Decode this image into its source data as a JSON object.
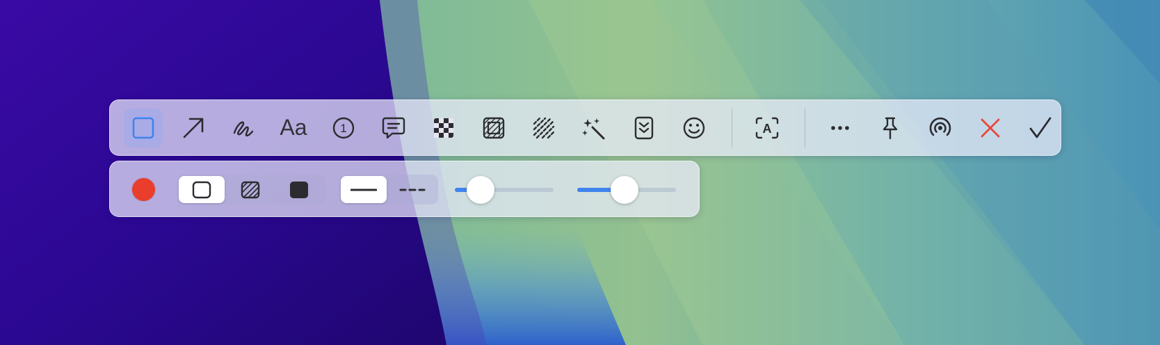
{
  "main_toolbar": {
    "tools": [
      {
        "name": "rectangle",
        "icon": "rectangle-icon",
        "active": true
      },
      {
        "name": "arrow",
        "icon": "arrow-icon"
      },
      {
        "name": "pen",
        "icon": "scribble-icon"
      },
      {
        "name": "text",
        "icon": "text-icon",
        "label": "Aa"
      },
      {
        "name": "counter",
        "icon": "numbered-circle-icon",
        "label": "1"
      },
      {
        "name": "comment",
        "icon": "speech-bubble-icon"
      },
      {
        "name": "pixelate",
        "icon": "checkerboard-icon"
      },
      {
        "name": "blur-region",
        "icon": "hatched-square-icon"
      },
      {
        "name": "blur",
        "icon": "diagonal-lines-icon"
      },
      {
        "name": "magic",
        "icon": "magic-wand-icon"
      },
      {
        "name": "scroll-capture",
        "icon": "chevrons-down-icon"
      },
      {
        "name": "emoji",
        "icon": "smiley-icon"
      }
    ],
    "ocr_tool": {
      "icon": "text-recognition-icon",
      "label": "A"
    },
    "actions": [
      {
        "name": "more",
        "icon": "ellipsis-icon"
      },
      {
        "name": "pin",
        "icon": "pin-icon"
      },
      {
        "name": "share",
        "icon": "airdrop-icon"
      },
      {
        "name": "cancel",
        "icon": "close-icon",
        "color": "#e8463a"
      },
      {
        "name": "confirm",
        "icon": "checkmark-icon"
      }
    ]
  },
  "options_bar": {
    "color": "#ea3e2c",
    "fill_styles": [
      {
        "name": "outline",
        "icon": "outline-square-icon",
        "selected": true
      },
      {
        "name": "hatched",
        "icon": "hatched-fill-icon"
      },
      {
        "name": "solid",
        "icon": "solid-fill-icon"
      }
    ],
    "line_styles": [
      {
        "name": "solid",
        "icon": "solid-line-icon",
        "selected": true
      },
      {
        "name": "dashed",
        "icon": "dashed-line-icon"
      }
    ],
    "sliders": [
      {
        "name": "stroke-width",
        "value": 0.26
      },
      {
        "name": "opacity",
        "value": 0.48
      }
    ],
    "accent": "#3f84ee"
  }
}
